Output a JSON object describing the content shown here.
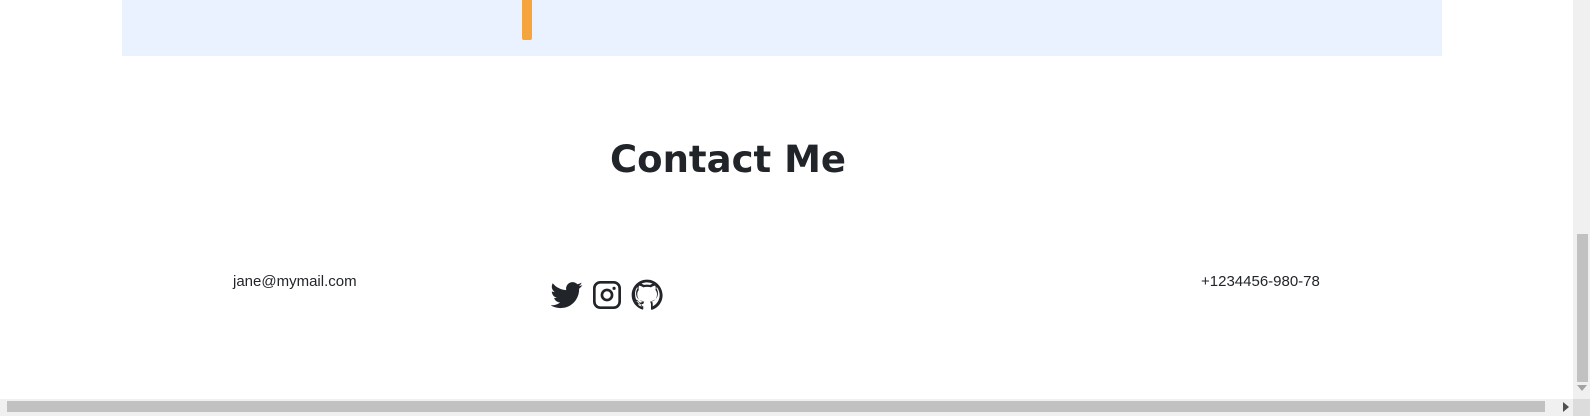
{
  "colors": {
    "band_background": "#ebf2ff",
    "band_marker": "#f6a53c",
    "text": "#212529"
  },
  "contact": {
    "title": "Contact Me",
    "email": "jane@mymail.com",
    "phone": "+1234456-980-78",
    "social": [
      {
        "name": "twitter",
        "icon": "twitter-icon"
      },
      {
        "name": "instagram",
        "icon": "instagram-icon"
      },
      {
        "name": "github",
        "icon": "github-icon"
      }
    ]
  }
}
